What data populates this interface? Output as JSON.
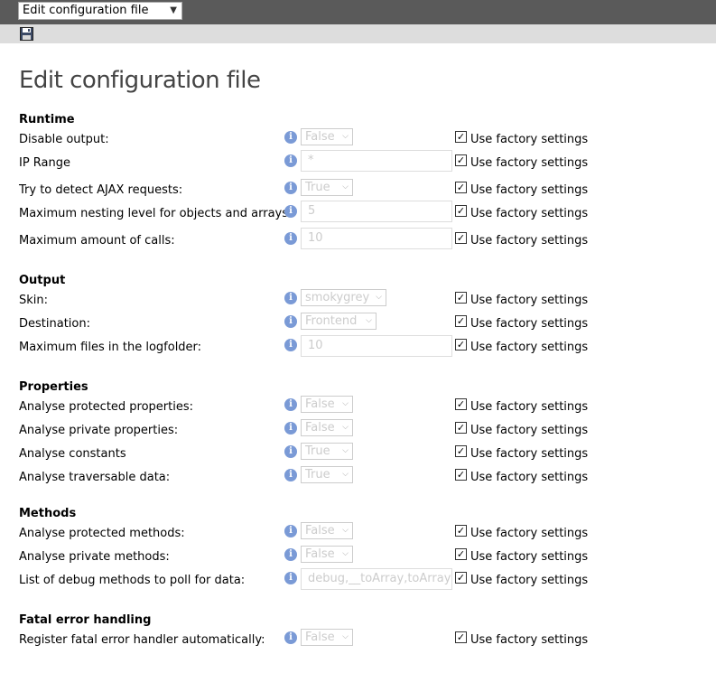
{
  "header": {
    "view_select": "Edit configuration file"
  },
  "toolbar": {
    "save_icon": "floppy-disk-icon"
  },
  "page": {
    "title": "Edit configuration file"
  },
  "factory_label": "Use factory settings",
  "sections": {
    "runtime": "Runtime",
    "output": "Output",
    "properties": "Properties",
    "methods": "Methods",
    "fatal": "Fatal error handling"
  },
  "settings": {
    "disable_output": {
      "label": "Disable output:",
      "value": "False"
    },
    "ip_range": {
      "label": "IP Range",
      "value": "*"
    },
    "detect_ajax": {
      "label": "Try to detect AJAX requests:",
      "value": "True"
    },
    "max_nesting": {
      "label": "Maximum nesting level for objects and arrays:",
      "value": "5"
    },
    "max_calls": {
      "label": "Maximum amount of calls:",
      "value": "10"
    },
    "skin": {
      "label": "Skin:",
      "value": "smokygrey"
    },
    "destination": {
      "label": "Destination:",
      "value": "Frontend"
    },
    "max_files": {
      "label": "Maximum files in the logfolder:",
      "value": "10"
    },
    "protected_props": {
      "label": "Analyse protected properties:",
      "value": "False"
    },
    "private_props": {
      "label": "Analyse private properties:",
      "value": "False"
    },
    "constants": {
      "label": "Analyse constants",
      "value": "True"
    },
    "traversable": {
      "label": "Analyse traversable data:",
      "value": "True"
    },
    "protected_methods": {
      "label": "Analyse protected methods:",
      "value": "False"
    },
    "private_methods": {
      "label": "Analyse private methods:",
      "value": "False"
    },
    "debug_methods": {
      "label": "List of debug methods to poll for data:",
      "value": "debug,__toArray,toArray"
    },
    "fatal_handler": {
      "label": "Register fatal error handler automatically:",
      "value": "False"
    }
  },
  "info_icon": "info-icon",
  "checkbox_state": "checked"
}
